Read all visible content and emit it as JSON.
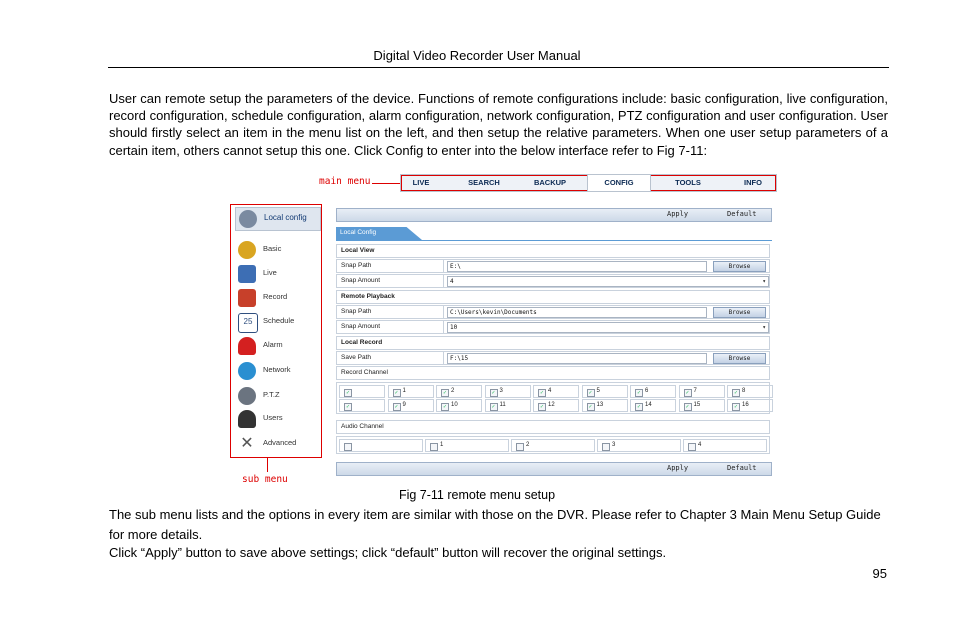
{
  "header": {
    "title": "Digital Video Recorder User Manual"
  },
  "intro_text": "User can remote setup the parameters of the device. Functions of remote configurations include: basic configuration, live configuration, record configuration, schedule configuration, alarm configuration, network configuration, PTZ configuration and user configuration. User should firstly select an item in the menu list on the left, and then setup the relative parameters. When one user setup parameters of a certain item, others cannot setup this one. Click Config to enter into the below interface refer to Fig 7-11:",
  "figure": {
    "main_menu_label": "main menu",
    "sub_menu_label": "sub menu",
    "tabs": [
      "LIVE",
      "SEARCH",
      "BACKUP",
      "CONFIG",
      "TOOLS",
      "INFO"
    ],
    "active_tab": "CONFIG",
    "sidebar": [
      {
        "label": "Local config",
        "icon": "gears-icon",
        "color": "#7a8aa0"
      },
      {
        "label": "Basic",
        "icon": "gear-icon",
        "color": "#d9a521"
      },
      {
        "label": "Live",
        "icon": "chart-icon",
        "color": "#3d6eb4"
      },
      {
        "label": "Record",
        "icon": "film-icon",
        "color": "#c7402a"
      },
      {
        "label": "Schedule",
        "icon": "calendar-icon",
        "color": "#2f4f7f"
      },
      {
        "label": "Alarm",
        "icon": "alarm-icon",
        "color": "#d42020"
      },
      {
        "label": "Network",
        "icon": "globe-icon",
        "color": "#2a8fd1"
      },
      {
        "label": "P.T.Z",
        "icon": "camera-icon",
        "color": "#6b7480"
      },
      {
        "label": "Users",
        "icon": "users-icon",
        "color": "#333333"
      },
      {
        "label": "Advanced",
        "icon": "tools-icon",
        "color": "#555555"
      }
    ],
    "apply_label": "Apply",
    "default_label": "Default",
    "config_tab": "Local Config",
    "local_view_heading": "Local View",
    "snap_path_label": "Snap Path",
    "snap_path_value": "E:\\",
    "snap_amount_label": "Snap Amount",
    "snap_amount_value": "4",
    "remote_playback_heading": "Remote Playback",
    "rp_snap_path_value": "C:\\Users\\kevin\\Documents",
    "rp_snap_amount_value": "10",
    "local_record_heading": "Local Record",
    "save_path_label": "Save Path",
    "save_path_value": "F:\\15",
    "record_channel_label": "Record Channel",
    "browse_label": "Browse",
    "record_channels_row1": [
      "",
      "1",
      "2",
      "3",
      "4",
      "5",
      "6",
      "7",
      "8"
    ],
    "record_channels_row2": [
      "",
      "9",
      "10",
      "11",
      "12",
      "13",
      "14",
      "15",
      "16"
    ],
    "audio_channel_label": "Audio Channel",
    "audio_channels": [
      "",
      "1",
      "2",
      "3",
      "4"
    ]
  },
  "caption": "Fig 7-11 remote menu setup",
  "body_text_1": "The sub menu lists and the options in every item are similar with those on the DVR. Please refer to Chapter 3 Main Menu Setup Guide for more details.",
  "body_text_2": "Click “Apply” button to save above settings; click “default” button will recover the original settings.",
  "page_number": "95"
}
